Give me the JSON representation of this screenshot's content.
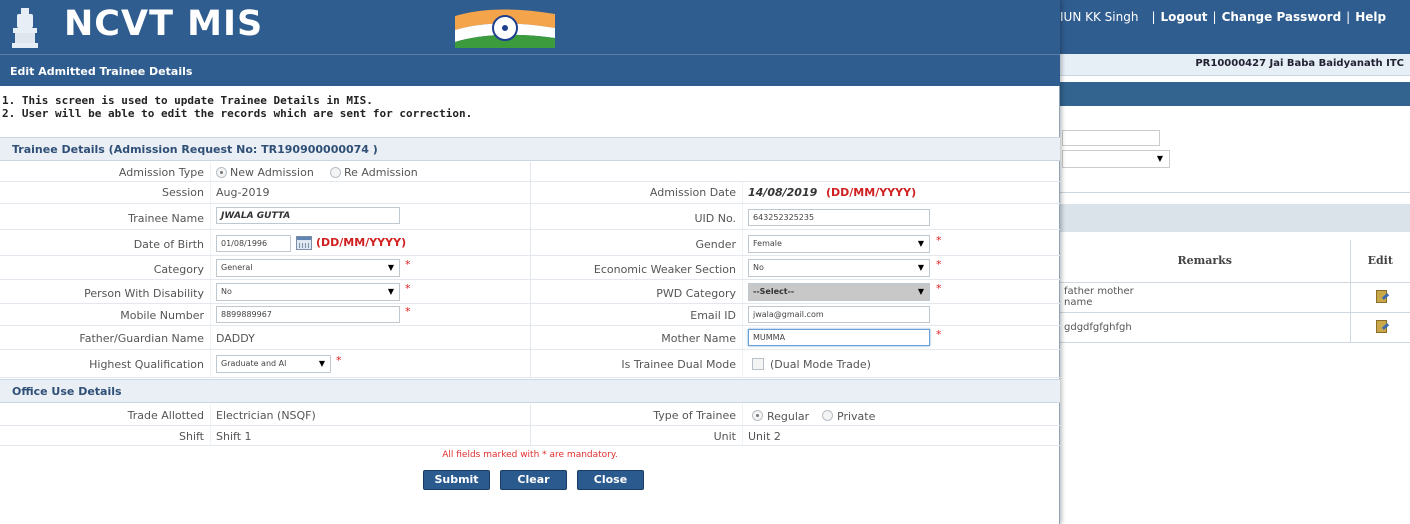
{
  "header": {
    "app_title": "NCVT MIS",
    "user_name": "IUN KK Singh",
    "logout": "Logout",
    "change_password": "Change Password",
    "help": "Help",
    "sep1": "|",
    "sep2": "|",
    "sep3": "|",
    "institute": "PR10000427 Jai Baba Baidyanath ITC"
  },
  "background_table": {
    "col_remarks": "Remarks",
    "col_edit": "Edit",
    "rows": [
      {
        "remarks_line1": "father mother",
        "remarks_line2": "name"
      },
      {
        "remarks_line1": "gdgdfgfghfgh",
        "remarks_line2": ""
      }
    ]
  },
  "modal": {
    "title": "Edit Admitted Trainee Details",
    "notes": [
      "1. This screen is used to update Trainee Details in MIS.",
      "2. User will be able to edit the records which are sent for correction."
    ],
    "trainee_section": "Trainee Details (Admission Request No: TR190900000074 )",
    "office_section": "Office Use Details",
    "fields": {
      "admission_type_label": "Admission Type",
      "admission_type_opt1": "New Admission",
      "admission_type_opt2": "Re Admission",
      "session_label": "Session",
      "session_value": "Aug-2019",
      "admission_date_label": "Admission Date",
      "admission_date_value": "14/08/2019",
      "admission_date_fmt": "(DD/MM/YYYY)",
      "trainee_name_label": "Trainee Name",
      "trainee_name_value": "JWALA GUTTA",
      "uid_label": "UID No.",
      "uid_value": "643252325235",
      "dob_label": "Date of Birth",
      "dob_value": "01/08/1996",
      "dob_fmt": "(DD/MM/YYYY)",
      "gender_label": "Gender",
      "gender_value": "Female",
      "category_label": "Category",
      "category_value": "General",
      "ews_label": "Economic Weaker Section",
      "ews_value": "No",
      "pwd_label": "Person With Disability",
      "pwd_value": "No",
      "pwd_cat_label": "PWD Category",
      "pwd_cat_value": "--Select--",
      "mobile_label": "Mobile Number",
      "mobile_value": "8899889967",
      "email_label": "Email ID",
      "email_value": "jwala@gmail.com",
      "father_label": "Father/Guardian Name",
      "father_value": "DADDY",
      "mother_label": "Mother Name",
      "mother_value": "MUMMA",
      "qual_label": "Highest Qualification",
      "qual_value": "Graduate and Al",
      "dual_label": "Is Trainee Dual Mode",
      "dual_text": "(Dual Mode Trade)",
      "trade_label": "Trade Allotted",
      "trade_value": "Electrician (NSQF)",
      "type_label": "Type of Trainee",
      "type_opt1": "Regular",
      "type_opt2": "Private",
      "shift_label": "Shift",
      "shift_value": "Shift 1",
      "unit_label": "Unit",
      "unit_value": "Unit 2",
      "req_mark": "*"
    },
    "mandatory_note": "All fields marked with * are mandatory.",
    "buttons": {
      "submit": "Submit",
      "clear": "Clear",
      "close": "Close"
    }
  },
  "colors": {
    "header_blue": "#2f5d8f",
    "required_red": "#e02020",
    "button_blue": "#2a5a8e"
  }
}
